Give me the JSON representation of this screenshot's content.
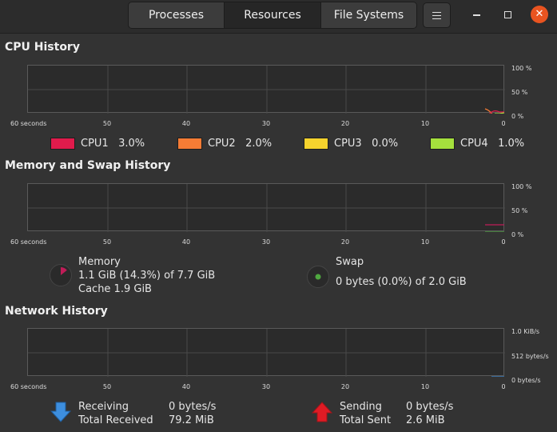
{
  "tabs": [
    {
      "label": "Processes"
    },
    {
      "label": "Resources"
    },
    {
      "label": "File Systems"
    }
  ],
  "active_tab": "Resources",
  "window_controls": {
    "close_glyph": "✕"
  },
  "x_axis": {
    "labels": [
      "60 seconds",
      "50",
      "40",
      "30",
      "20",
      "10",
      "0"
    ]
  },
  "cpu": {
    "title": "CPU History",
    "y_axis": [
      "100 %",
      "50 %",
      "0 %"
    ],
    "legend": [
      {
        "name": "CPU1",
        "value": "3.0%",
        "color": "#e01b4c"
      },
      {
        "name": "CPU2",
        "value": "2.0%",
        "color": "#f57c35"
      },
      {
        "name": "CPU3",
        "value": "0.0%",
        "color": "#f6d32d"
      },
      {
        "name": "CPU4",
        "value": "1.0%",
        "color": "#a5e03d"
      }
    ]
  },
  "memory": {
    "title": "Memory and Swap History",
    "y_axis": [
      "100 %",
      "50 %",
      "0 %"
    ],
    "memory_label": "Memory",
    "memory_usage": "1.1 GiB (14.3%) of 7.7 GiB",
    "memory_cache": "Cache 1.9 GiB",
    "memory_fraction": 0.143,
    "memory_color": "#c01c58",
    "swap_label": "Swap",
    "swap_usage": "0 bytes (0.0%) of 2.0 GiB",
    "swap_color": "#4fa840"
  },
  "network": {
    "title": "Network History",
    "y_axis": [
      "1.0 KiB/s",
      "512 bytes/s",
      "0 bytes/s"
    ],
    "receiving_label": "Receiving",
    "receiving_rate": "0 bytes/s",
    "total_received_label": "Total Received",
    "total_received": "79.2 MiB",
    "sending_label": "Sending",
    "sending_rate": "0 bytes/s",
    "total_sent_label": "Total Sent",
    "total_sent": "2.6 MiB",
    "receive_color": "#3d8ede",
    "send_color": "#e01b24"
  }
}
